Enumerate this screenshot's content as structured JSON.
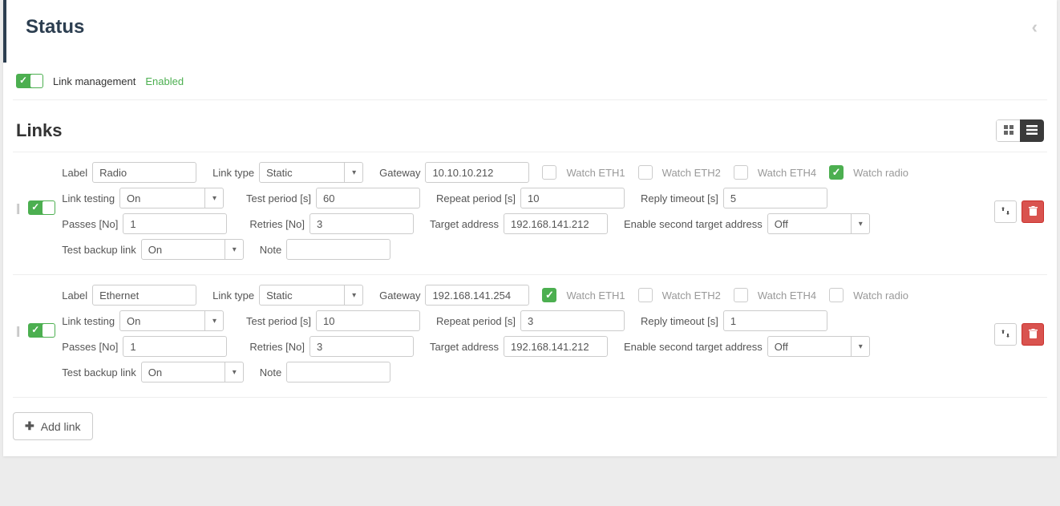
{
  "panel": {
    "title": "Status",
    "link_management_label": "Link management",
    "link_management_status": "Enabled"
  },
  "links_section": {
    "title": "Links",
    "add_link_label": "Add link"
  },
  "field_labels": {
    "label": "Label",
    "link_type": "Link type",
    "gateway": "Gateway",
    "watch_eth1": "Watch ETH1",
    "watch_eth2": "Watch ETH2",
    "watch_eth4": "Watch ETH4",
    "watch_radio": "Watch radio",
    "link_testing": "Link testing",
    "test_period": "Test period [s]",
    "repeat_period": "Repeat period [s]",
    "reply_timeout": "Reply timeout [s]",
    "passes": "Passes [No]",
    "retries": "Retries [No]",
    "target_address": "Target address",
    "enable_second_target": "Enable second target address",
    "test_backup_link": "Test backup link",
    "note": "Note"
  },
  "links": [
    {
      "label": "Radio",
      "link_type": "Static",
      "gateway": "10.10.10.212",
      "watch_eth1": false,
      "watch_eth2": false,
      "watch_eth4": false,
      "watch_radio": true,
      "link_testing": "On",
      "test_period": "60",
      "repeat_period": "10",
      "reply_timeout": "5",
      "passes": "1",
      "retries": "3",
      "target_address": "192.168.141.212",
      "enable_second_target": "Off",
      "test_backup_link": "On",
      "note": ""
    },
    {
      "label": "Ethernet",
      "link_type": "Static",
      "gateway": "192.168.141.254",
      "watch_eth1": true,
      "watch_eth2": false,
      "watch_eth4": false,
      "watch_radio": false,
      "link_testing": "On",
      "test_period": "10",
      "repeat_period": "3",
      "reply_timeout": "1",
      "passes": "1",
      "retries": "3",
      "target_address": "192.168.141.212",
      "enable_second_target": "Off",
      "test_backup_link": "On",
      "note": ""
    }
  ]
}
